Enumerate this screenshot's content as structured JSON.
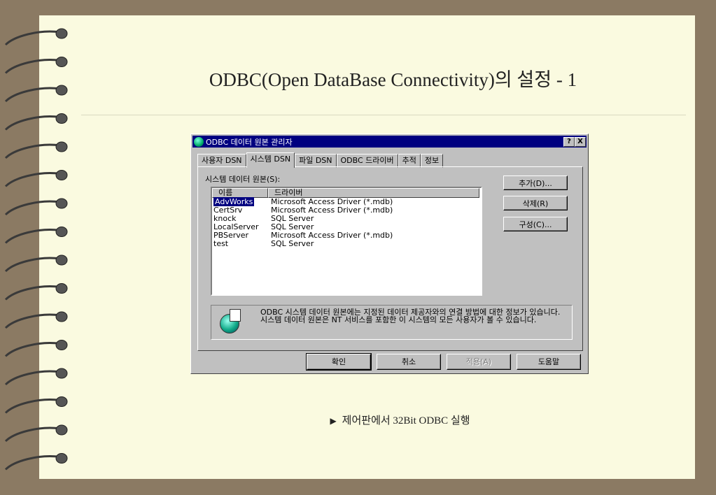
{
  "slide": {
    "title": "ODBC(Open DataBase Connectivity)의 설정 - 1",
    "caption_marker": "▶",
    "caption": "제어판에서 32Bit ODBC 실행"
  },
  "dialog": {
    "title": "ODBC 데이터 원본 관리자",
    "help_btn": "?",
    "close_btn": "X",
    "tabs": [
      "사용자 DSN",
      "시스템 DSN",
      "파일 DSN",
      "ODBC 드라이버",
      "추적",
      "정보"
    ],
    "active_tab": "시스템 DSN",
    "list_label": "시스템 데이터 원본(S):",
    "columns": [
      "이름",
      "드라이버"
    ],
    "rows": [
      {
        "name": "AdvWorks",
        "driver": "Microsoft Access Driver (*.mdb)",
        "selected": true
      },
      {
        "name": "CertSrv",
        "driver": "Microsoft Access Driver (*.mdb)"
      },
      {
        "name": "knock",
        "driver": "SQL Server"
      },
      {
        "name": "LocalServer",
        "driver": "SQL Server"
      },
      {
        "name": "PBServer",
        "driver": "Microsoft Access Driver (*.mdb)"
      },
      {
        "name": "test",
        "driver": "SQL Server"
      }
    ],
    "side_buttons": {
      "add": "추가(D)...",
      "remove": "삭제(R)",
      "configure": "구성(C)..."
    },
    "info_text": "ODBC 시스템 데이터 원본에는 지정된 데이터 제공자와의 연결 방법에 대한 정보가 있습니다. 시스템 데이터 원본은 NT 서비스를 포함한 이 시스템의 모든 사용자가 볼 수 있습니다.",
    "bottom_buttons": {
      "ok": "확인",
      "cancel": "취소",
      "apply": "적용(A)",
      "help": "도움말"
    }
  }
}
